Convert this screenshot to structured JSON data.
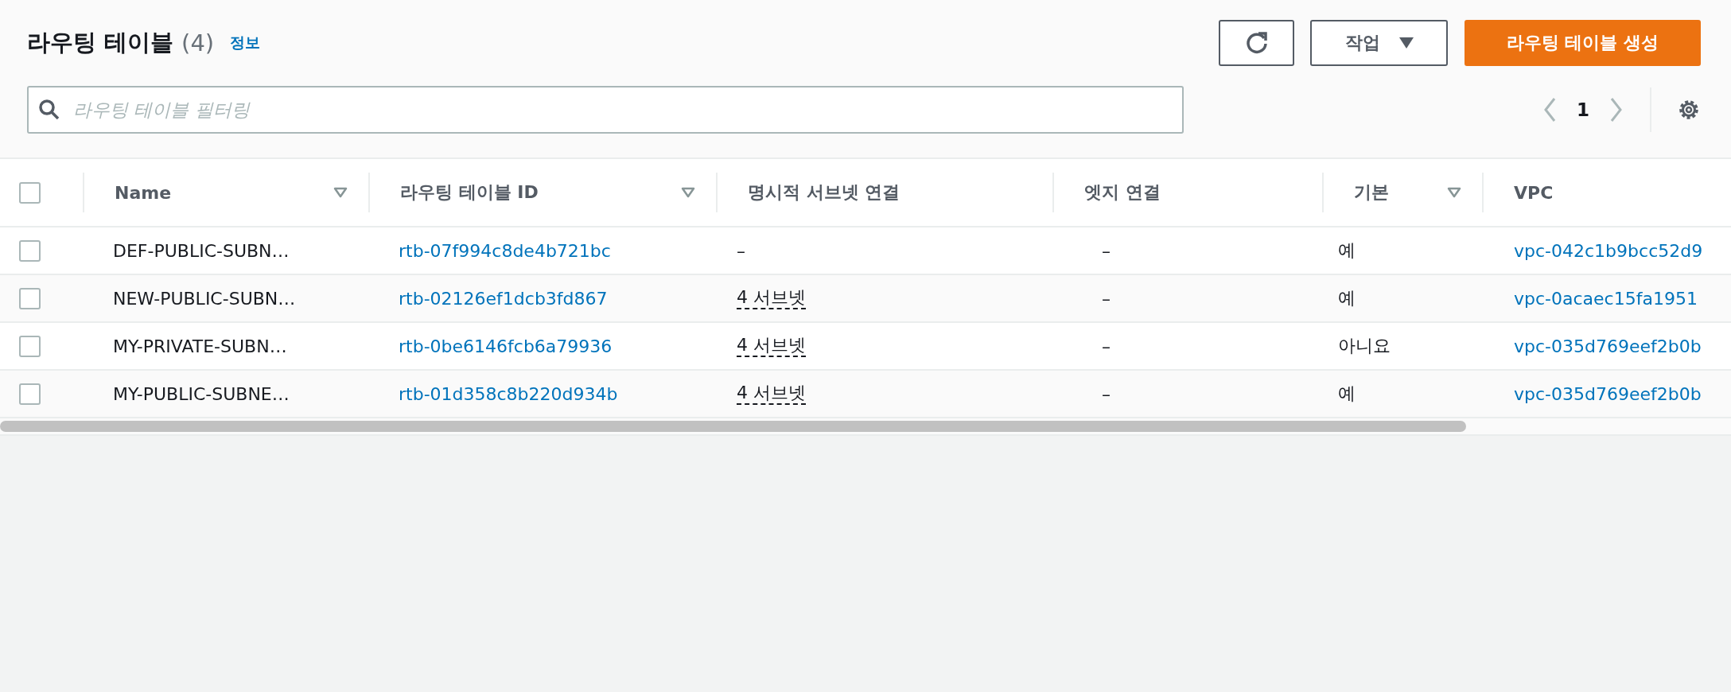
{
  "header": {
    "title": "라우팅 테이블",
    "count": "(4)",
    "info_link": "정보",
    "actions_button": "작업",
    "create_button": "라우팅 테이블 생성"
  },
  "filter": {
    "placeholder": "라우팅 테이블 필터링"
  },
  "pagination": {
    "page": "1",
    "prev_disabled": true,
    "next_disabled": true
  },
  "table": {
    "select_all_checked": false,
    "columns": [
      {
        "label": "Name",
        "sortable": true
      },
      {
        "label": "라우팅 테이블 ID",
        "sortable": true
      },
      {
        "label": "명시적 서브넷 연결",
        "sortable": false
      },
      {
        "label": "엣지 연결",
        "sortable": false
      },
      {
        "label": "기본",
        "sortable": true
      },
      {
        "label": "VPC",
        "sortable": false
      }
    ],
    "rows": [
      {
        "checked": false,
        "name": "DEF-PUBLIC-SUBN…",
        "id": "rtb-07f994c8de4b721bc",
        "subnets": "–",
        "subnets_linked": false,
        "edge": "–",
        "main": "예",
        "vpc": "vpc-042c1b9bcc52d9"
      },
      {
        "checked": false,
        "name": "NEW-PUBLIC-SUBN…",
        "id": "rtb-02126ef1dcb3fd867",
        "subnets": "4 서브넷",
        "subnets_linked": true,
        "edge": "–",
        "main": "예",
        "vpc": "vpc-0acaec15fa1951"
      },
      {
        "checked": false,
        "name": "MY-PRIVATE-SUBN…",
        "id": "rtb-0be6146fcb6a79936",
        "subnets": "4 서브넷",
        "subnets_linked": true,
        "edge": "–",
        "main": "아니요",
        "vpc": "vpc-035d769eef2b0b"
      },
      {
        "checked": false,
        "name": "MY-PUBLIC-SUBNE…",
        "id": "rtb-01d358c8b220d934b",
        "subnets": "4 서브넷",
        "subnets_linked": true,
        "edge": "–",
        "main": "예",
        "vpc": "vpc-035d769eef2b0b"
      }
    ]
  }
}
